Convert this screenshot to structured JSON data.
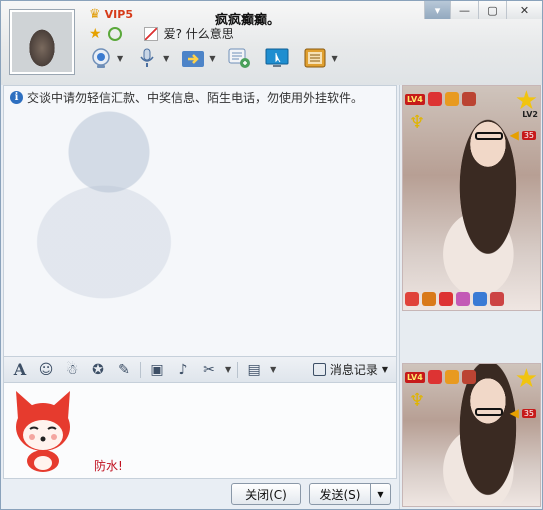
{
  "header": {
    "vip_label": "VIP5",
    "nickname": "疯疯癫癫。",
    "status_text": "爱? 什么意思"
  },
  "toolbar": {
    "items": [
      {
        "icon": "webcam-icon",
        "color": "#3b7bd0"
      },
      {
        "icon": "microphone-icon",
        "color": "#4a6fa0"
      },
      {
        "icon": "file-transfer-icon",
        "color": "#e6a020"
      },
      {
        "icon": "group-chat-icon",
        "color": "#49a05a"
      },
      {
        "icon": "remote-desktop-icon",
        "color": "#1f8ed0"
      },
      {
        "icon": "app-box-icon",
        "color": "#d08a20"
      }
    ]
  },
  "chat": {
    "notice": "交谈中请勿轻信汇款、中奖信息、陌生电话，勿使用外挂软件。"
  },
  "format_bar": {
    "history_label": "消息记录"
  },
  "input": {
    "sticker_caption": "防水!"
  },
  "buttons": {
    "close_label": "关闭(C)",
    "send_label": "发送(S)"
  },
  "right_panel": {
    "cards": [
      {
        "level": "LV4",
        "badge_number": "35",
        "level_label": "LV2"
      },
      {
        "level": "LV4",
        "badge_number": "35"
      }
    ]
  },
  "colors": {
    "accent": "#2d6fc0",
    "vip": "#d63b1a",
    "sticker_text": "#c0111f"
  }
}
